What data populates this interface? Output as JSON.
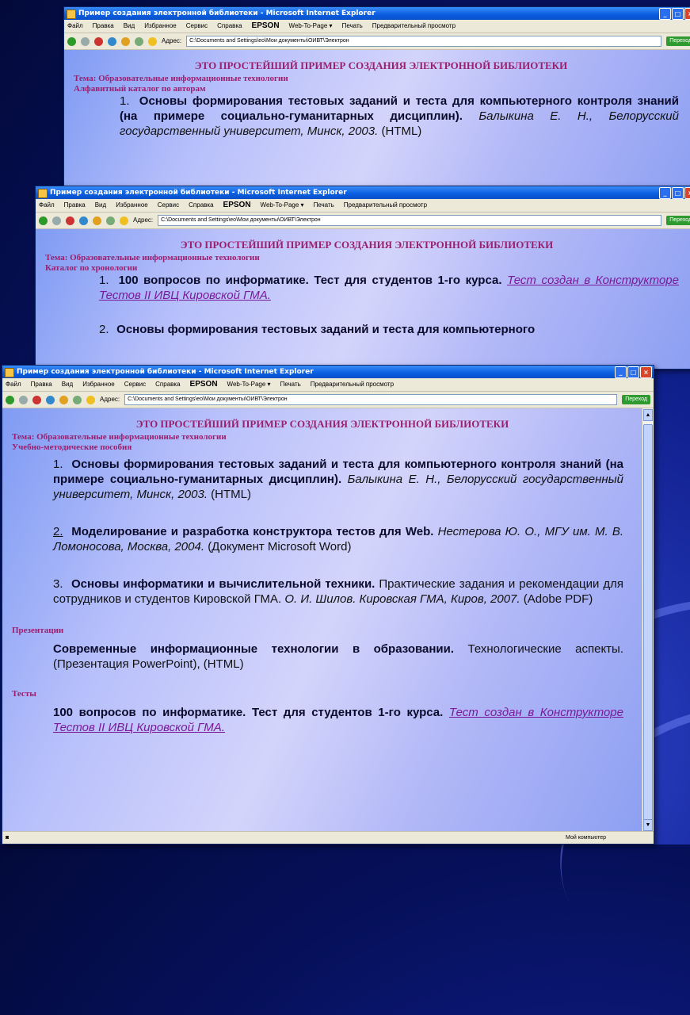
{
  "window_title": "Пример создания электронной библиотеки - Microsoft Internet Explorer",
  "menu": [
    "Файл",
    "Правка",
    "Вид",
    "Избранное",
    "Сервис",
    "Справка"
  ],
  "menu_epson": "EPSON",
  "menu_web_to_page": "Web-To-Page ▾",
  "menu_print": "Печать",
  "menu_preview": "Предварительный просмотр",
  "address_label": "Адрес:",
  "address_value": "C:\\Documents and Settings\\eo\\Мои документы\\ОИВТ\\Электрон",
  "go_label": "Переход",
  "status_text": "Мой компьютер",
  "page_heading": "ЭТО ПРОСТЕЙШИЙ ПРИМЕР СОЗДАНИЯ ЭЛЕКТРОННОЙ БИБЛИОТЕКИ",
  "topic": "Тема: Образовательные информационные технологии",
  "window1": {
    "section": "Алфавитный каталог по авторам",
    "item1_num": "1.",
    "item1_title": "Основы формирования тестовых заданий и теста для компьютерного контроля знаний (на примере социально-гуманитарных дисциплин).",
    "item1_author": "Балыкина Е. Н., Белорусский государственный университет, Минск, 2003.",
    "item1_format": "(HTML)"
  },
  "window2": {
    "section": "Каталог по хронологии",
    "item1_num": "1.",
    "item1_title": "100 вопросов по информатике. Тест для студентов 1-го курса.",
    "item1_link": "Тест создан в Конструкторе Тестов II ИВЦ Кировской ГМА.",
    "item2_num": "2.",
    "item2_title": "Основы формирования тестовых заданий и теста для компьютерного"
  },
  "window3": {
    "section": "Учебно-методические пособия",
    "item1_num": "1.",
    "item1_title": "Основы формирования тестовых заданий и теста для компьютерного контроля знаний (на примере социально-гуманитарных дисциплин).",
    "item1_author": "Балыкина Е. Н., Белорусский государственный университет, Минск, 2003.",
    "item1_format": "(HTML)",
    "item2_num": "2.",
    "item2_title": "Моделирование и разработка конструктора тестов для Web.",
    "item2_author": "Нестерова Ю. О., МГУ им. М. В. Ломоносова, Москва, 2004.",
    "item2_format": "(Документ Microsoft Word)",
    "item3_num": "3.",
    "item3_title": "Основы информатики и вычислительной техники.",
    "item3_desc": "Практические задания и рекомендации для сотрудников и студентов Кировской ГМА.",
    "item3_author": "О. И. Шилов. Кировская ГМА, Киров, 2007.",
    "item3_format": "(Adobe PDF)",
    "section_presentations": "Презентации",
    "pres_title": "Современные информационные технологии в образовании.",
    "pres_desc": "Технологические аспекты. (Презентация PowerPoint), (HTML)",
    "section_tests": "Тесты",
    "test_title": "100 вопросов по информатике. Тест для студентов 1-го курса.",
    "test_link": "Тест создан в Конструкторе Тестов II ИВЦ Кировской ГМА."
  }
}
